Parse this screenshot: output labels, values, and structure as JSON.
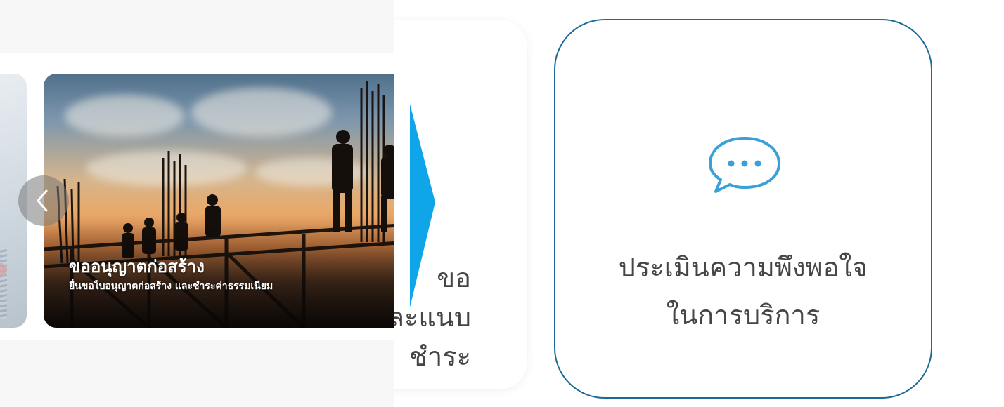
{
  "carousel": {
    "slides": [
      {
        "title": "ขออนุญาตก่อสร้าง",
        "subtitle": "ยื่นขอใบอนุญาตก่อสร้าง และชำระค่าธรรมเนียม"
      }
    ],
    "prev_icon": "chevron-left-icon"
  },
  "middle_card": {
    "lines": [
      "ขอ",
      "ละแนบ",
      "ชำระ"
    ]
  },
  "right_card": {
    "icon": "chat-bubble-icon",
    "lines": [
      "ประเมินความพึงพอใจ",
      "ในการบริการ"
    ]
  },
  "colors": {
    "arrow": "#0ea5e9",
    "card_border": "#1a6a97",
    "icon": "#3aa0d8",
    "text": "#454545"
  }
}
